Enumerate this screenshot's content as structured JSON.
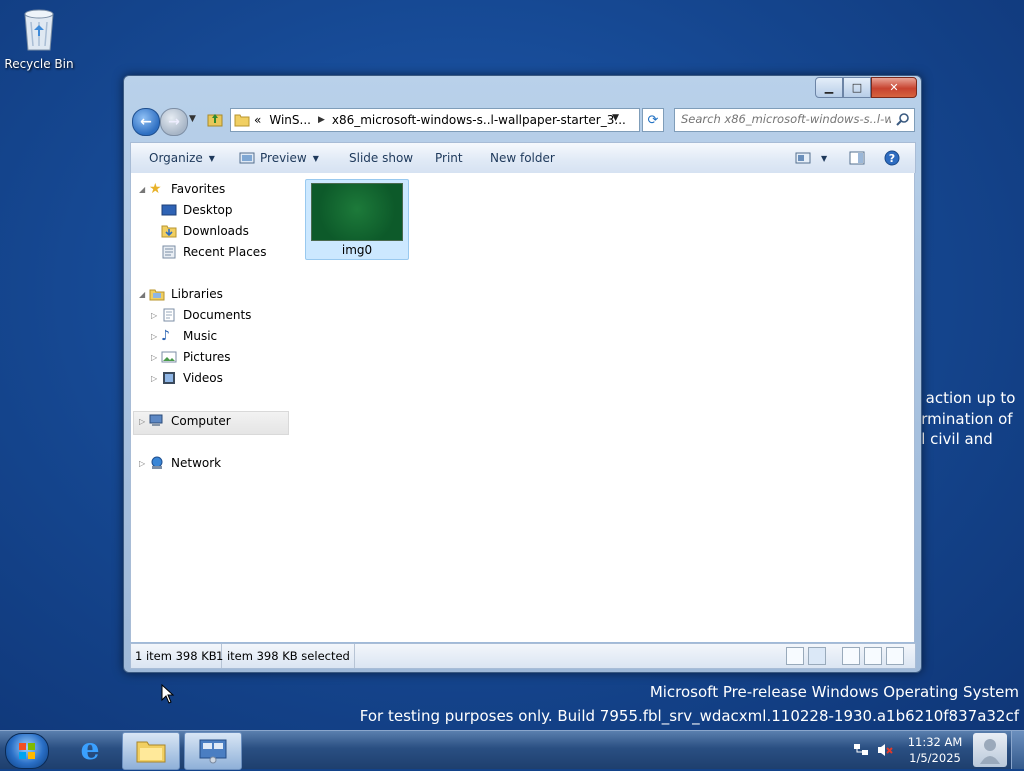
{
  "desktop": {
    "icons": [
      {
        "label": "Recycle Bin",
        "icon": "recycle-bin-icon"
      }
    ],
    "watermark": {
      "line1": "Microsoft Pre-release Windows Operating System",
      "line2": "For testing purposes only. Build 7955.fbl_srv_wdacxml.110228-1930.a1b6210f837a32cf"
    },
    "behind_window_text": {
      "line1": "y action up to",
      "line2": "ermination of",
      "line3": "al civil and"
    }
  },
  "window": {
    "buttons": {
      "minimize": "minimize-icon",
      "maximize": "maximize-icon",
      "close": "close-icon"
    },
    "address": {
      "prefix": "«",
      "segments": [
        "WinS...",
        "x86_microsoft-windows-s..l-wallpaper-starter_3..."
      ]
    },
    "search": {
      "placeholder": "Search x86_microsoft-windows-s..l-wa..."
    },
    "commands": {
      "organize": "Organize",
      "preview": "Preview",
      "slideshow": "Slide show",
      "print": "Print",
      "new_folder": "New folder"
    },
    "nav": {
      "favorites": "Favorites",
      "desktop": "Desktop",
      "downloads": "Downloads",
      "recent": "Recent Places",
      "libraries": "Libraries",
      "documents": "Documents",
      "music": "Music",
      "pictures": "Pictures",
      "videos": "Videos",
      "computer": "Computer",
      "network": "Network"
    },
    "files": [
      {
        "name": "img0",
        "selected": true
      }
    ],
    "status": {
      "items": "1 item 398 KB",
      "selected": "1 item 398 KB selected"
    }
  },
  "taskbar": {
    "clock": {
      "time": "11:32 AM",
      "date": "1/5/2025"
    },
    "pinned": [
      "start-orb-icon",
      "internet-explorer-icon",
      "windows-explorer-icon",
      "control-panel-icon"
    ]
  },
  "colors": {
    "desktop": "#15468f",
    "selection": "#cce8ff",
    "thumb_green": "#0d5a2a"
  }
}
